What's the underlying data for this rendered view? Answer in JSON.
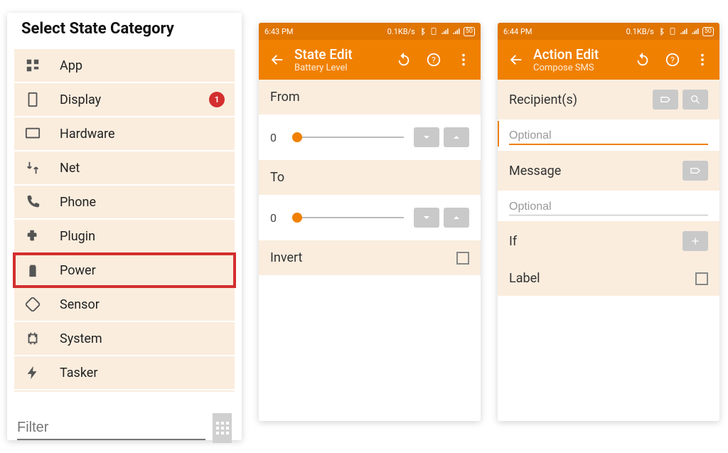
{
  "colors": {
    "accent": "#F08000",
    "accent_dark": "#E07500",
    "row_bg": "#FAEDDE",
    "danger": "#D32F2F"
  },
  "panel1": {
    "title": "Select State Category",
    "items": [
      {
        "icon": "app-icon",
        "label": "App"
      },
      {
        "icon": "display-icon",
        "label": "Display",
        "badge": "1"
      },
      {
        "icon": "hardware-icon",
        "label": "Hardware"
      },
      {
        "icon": "net-icon",
        "label": "Net"
      },
      {
        "icon": "phone-icon",
        "label": "Phone"
      },
      {
        "icon": "plugin-icon",
        "label": "Plugin"
      },
      {
        "icon": "power-icon",
        "label": "Power",
        "highlighted": true
      },
      {
        "icon": "sensor-icon",
        "label": "Sensor"
      },
      {
        "icon": "system-icon",
        "label": "System"
      },
      {
        "icon": "tasker-icon",
        "label": "Tasker"
      }
    ],
    "filter_placeholder": "Filter"
  },
  "panel2": {
    "status_time": "6:43 PM",
    "status_data": "0.1KB/s",
    "status_batt": "50",
    "appbar_title": "State Edit",
    "appbar_subtitle": "Battery Level",
    "from_label": "From",
    "from_value": "0",
    "to_label": "To",
    "to_value": "0",
    "invert_label": "Invert"
  },
  "panel3": {
    "status_time": "6:44 PM",
    "status_data": "0.1KB/s",
    "status_batt": "50",
    "appbar_title": "Action Edit",
    "appbar_subtitle": "Compose SMS",
    "recip_label": "Recipient(s)",
    "recip_placeholder": "Optional",
    "msg_label": "Message",
    "msg_placeholder": "Optional",
    "if_label": "If",
    "label_label": "Label"
  }
}
